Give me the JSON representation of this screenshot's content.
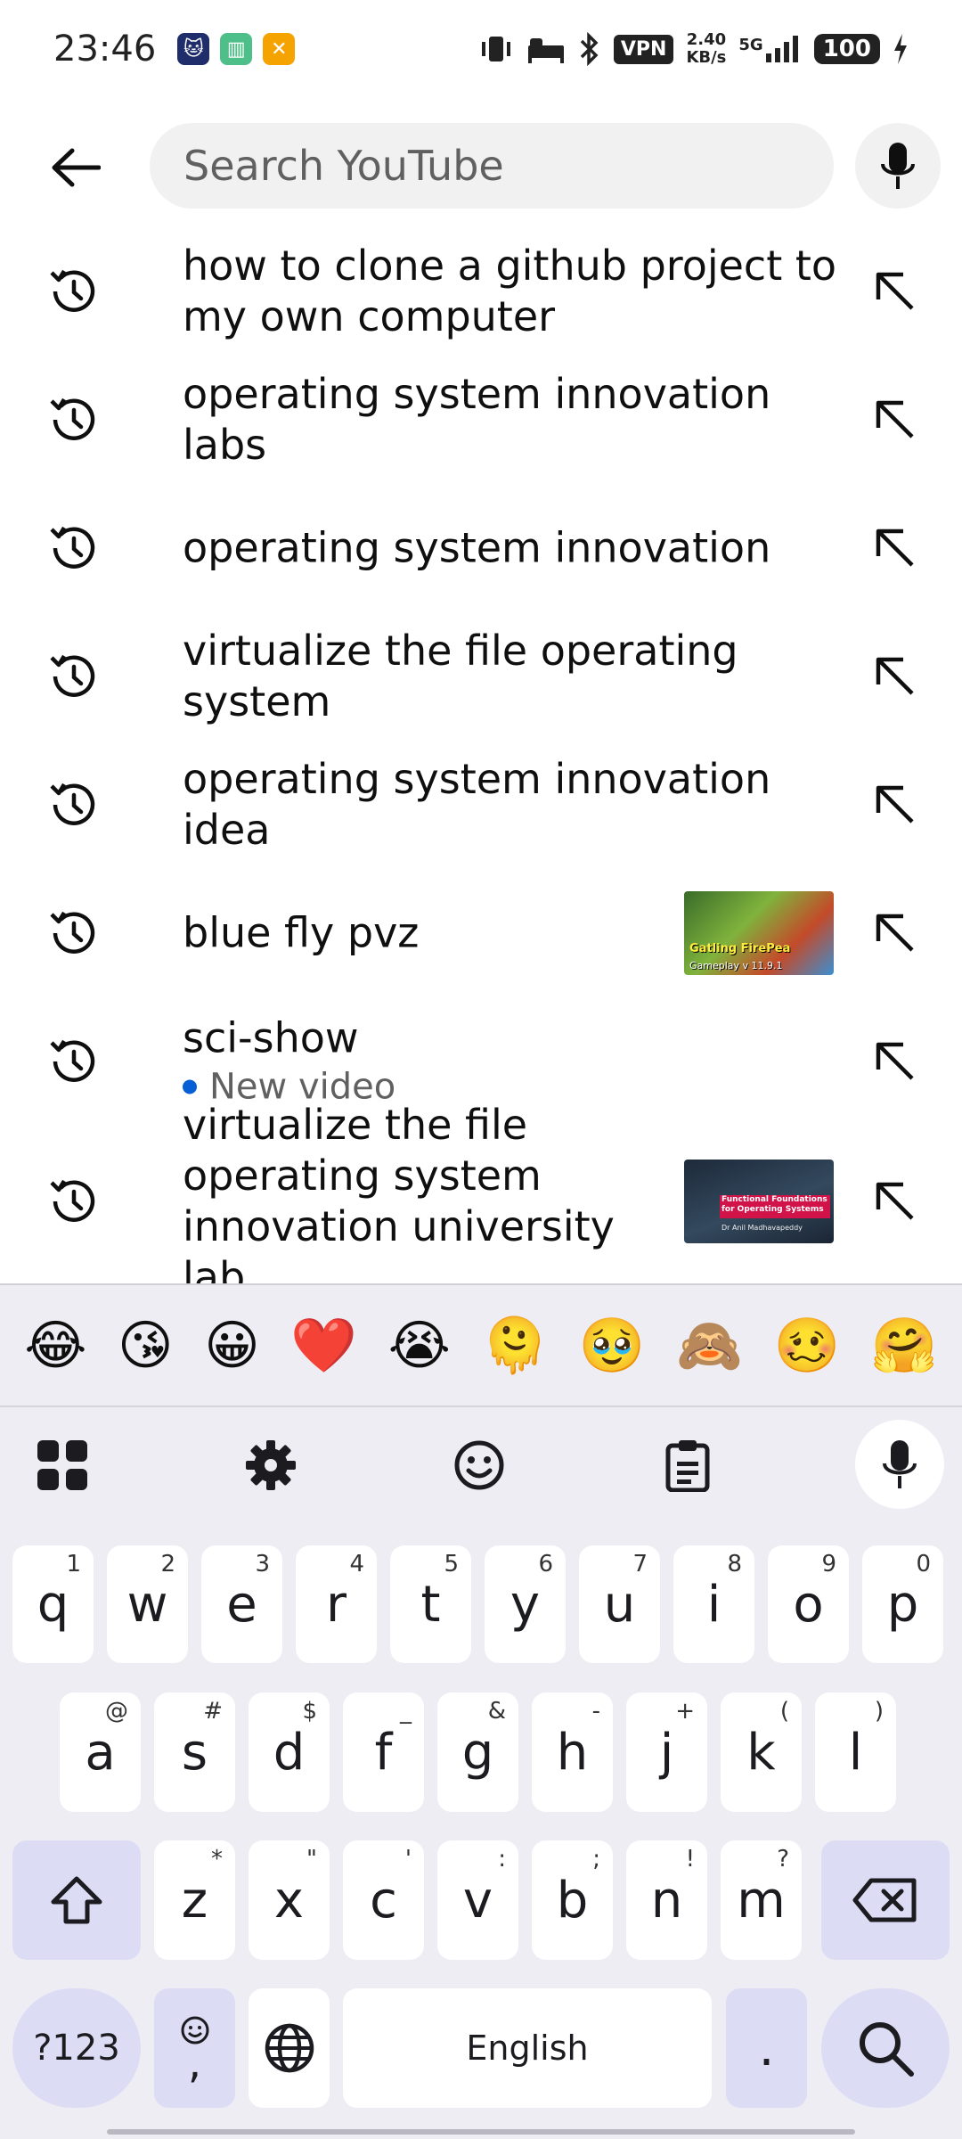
{
  "status_bar": {
    "time": "23:46",
    "vpn": "VPN",
    "net_speed_value": "2.40",
    "net_speed_unit": "KB/s",
    "network": "5G",
    "battery": "100"
  },
  "search": {
    "placeholder": "Search YouTube"
  },
  "suggestions": [
    {
      "text": "how to clone a github project to my own computer"
    },
    {
      "text": "operating system innovation labs"
    },
    {
      "text": "operating system innovation"
    },
    {
      "text": "virtualize the file operating system"
    },
    {
      "text": "operating system innovation idea"
    },
    {
      "text": "blue fly pvz",
      "thumbnail": {
        "title": "Gatling FirePea",
        "subtitle": "Gameplay v 11.9.1"
      }
    },
    {
      "text": "sci-show",
      "sub": "New video"
    },
    {
      "text": "virtualize the file operating system innovation university lab",
      "thumbnail": {
        "title": "Functional Foundations for Operating Systems",
        "subtitle": "Dr Anil Madhavapeddy"
      }
    }
  ],
  "emoji_bar": [
    "😂",
    "😘",
    "😀",
    "❤️",
    "😭",
    "🫠",
    "🥹",
    "🙈",
    "🥴",
    "🤗"
  ],
  "keyboard": {
    "row1": [
      {
        "key": "q",
        "hint": "1"
      },
      {
        "key": "w",
        "hint": "2"
      },
      {
        "key": "e",
        "hint": "3"
      },
      {
        "key": "r",
        "hint": "4"
      },
      {
        "key": "t",
        "hint": "5"
      },
      {
        "key": "y",
        "hint": "6"
      },
      {
        "key": "u",
        "hint": "7"
      },
      {
        "key": "i",
        "hint": "8"
      },
      {
        "key": "o",
        "hint": "9"
      },
      {
        "key": "p",
        "hint": "0"
      }
    ],
    "row2": [
      {
        "key": "a",
        "hint": "@"
      },
      {
        "key": "s",
        "hint": "#"
      },
      {
        "key": "d",
        "hint": "$"
      },
      {
        "key": "f",
        "hint": "_"
      },
      {
        "key": "g",
        "hint": "&"
      },
      {
        "key": "h",
        "hint": "-"
      },
      {
        "key": "j",
        "hint": "+"
      },
      {
        "key": "k",
        "hint": "("
      },
      {
        "key": "l",
        "hint": ")"
      }
    ],
    "row3": [
      {
        "key": "z",
        "hint": "*"
      },
      {
        "key": "x",
        "hint": "\""
      },
      {
        "key": "c",
        "hint": "'"
      },
      {
        "key": "v",
        "hint": ":"
      },
      {
        "key": "b",
        "hint": ";"
      },
      {
        "key": "n",
        "hint": "!"
      },
      {
        "key": "m",
        "hint": "?"
      }
    ],
    "symbols_label": "?123",
    "comma_label": ",",
    "space_label": "English",
    "period_label": "."
  },
  "colors": {
    "accent": "#065fd4",
    "keyboard_bg": "#eeedf4",
    "modifier_key": "#dcdcf5"
  }
}
